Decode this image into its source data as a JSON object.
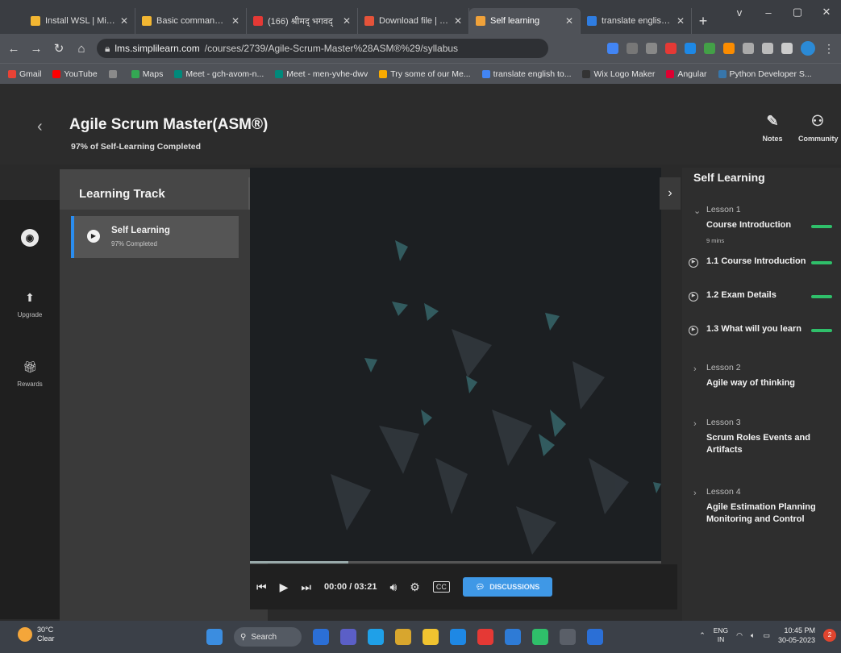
{
  "browser": {
    "tabs": [
      {
        "title": "Install WSL | Microsoft",
        "color": "#f2b632"
      },
      {
        "title": "Basic commands for",
        "color": "#f2b632"
      },
      {
        "title": "(166) श्रीमद् भगवद्",
        "color": "#e53935"
      },
      {
        "title": "Download file | iLove",
        "color": "#e5533a"
      },
      {
        "title": "Self learning",
        "color": "#f0a23a",
        "active": true
      },
      {
        "title": "translate english to m",
        "color": "#2f7de1"
      }
    ],
    "new_tab": "+",
    "window_controls": [
      "v",
      "–",
      "▢",
      "✕"
    ],
    "url_host": "lms.simplilearn.com",
    "url_path": "/courses/2739/Agile-Scrum-Master%28ASM®%29/syllabus",
    "bookmarks": [
      {
        "label": "Gmail",
        "color": "#e94235"
      },
      {
        "label": "YouTube",
        "color": "#ff0000"
      },
      {
        "label": "",
        "color": "#8a8a8a"
      },
      {
        "label": "Maps",
        "color": "#34a853"
      },
      {
        "label": "Meet - gch-avom-n...",
        "color": "#00897b"
      },
      {
        "label": "Meet - men-yvhe-dwv",
        "color": "#00897b"
      },
      {
        "label": "Try some of our Me...",
        "color": "#f9ab00"
      },
      {
        "label": "translate english to...",
        "color": "#4285f4"
      },
      {
        "label": "Wix Logo Maker",
        "color": "#333333"
      },
      {
        "label": "Angular",
        "color": "#dd0031"
      },
      {
        "label": "Python Developer S...",
        "color": "#3776ab"
      }
    ]
  },
  "course": {
    "title": "Agile Scrum Master(ASM®)",
    "subtitle": "97% of Self-Learning Completed",
    "notes_label": "Notes",
    "community_label": "Community"
  },
  "rail": {
    "upgrade_label": "Upgrade",
    "rewards_label": "Rewards"
  },
  "learning_track": {
    "title": "Learning Track",
    "item_label": "Self Learning",
    "item_sub": "97% Completed"
  },
  "player": {
    "time": "00:00 / 03:21",
    "progress_fraction": 0.24,
    "cc": "CC",
    "discussions_label": "DISCUSSIONS"
  },
  "sidebar": {
    "title": "Self Learning",
    "lesson1": {
      "label": "Lesson 1",
      "name": "Course Introduction",
      "mins": "9 mins"
    },
    "lectures": [
      {
        "name": "1.1 Course Introduction"
      },
      {
        "name": "1.2 Exam Details"
      },
      {
        "name": "1.3 What will you learn"
      }
    ],
    "lesson2": {
      "label": "Lesson 2",
      "name": "Agile way of thinking"
    },
    "lesson3": {
      "label": "Lesson 3",
      "name": "Scrum Roles Events and Artifacts"
    },
    "lesson4": {
      "label": "Lesson 4",
      "name": "Agile Estimation Planning Monitoring and Control"
    }
  },
  "taskbar": {
    "temp": "30°C",
    "weather": "Clear",
    "search_label": "Search",
    "lang1": "ENG",
    "lang2": "IN",
    "time": "10:45 PM",
    "date": "30-05-2023"
  }
}
